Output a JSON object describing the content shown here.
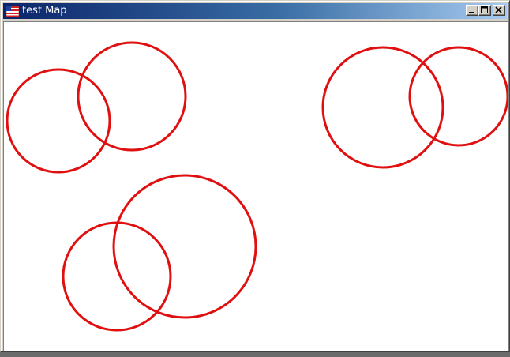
{
  "window": {
    "title": "test Map",
    "title_gradient": [
      "#0a246a",
      "#3a6ea5",
      "#a6caf0"
    ],
    "controls": [
      {
        "name": "minimize-button",
        "icon": "minimize-icon"
      },
      {
        "name": "maximize-button",
        "icon": "maximize-icon"
      },
      {
        "name": "close-button",
        "icon": "close-icon"
      }
    ]
  },
  "map": {
    "stroke_color": "#e01010",
    "background": "#ffffff",
    "circle_count_shown": 6
  }
}
